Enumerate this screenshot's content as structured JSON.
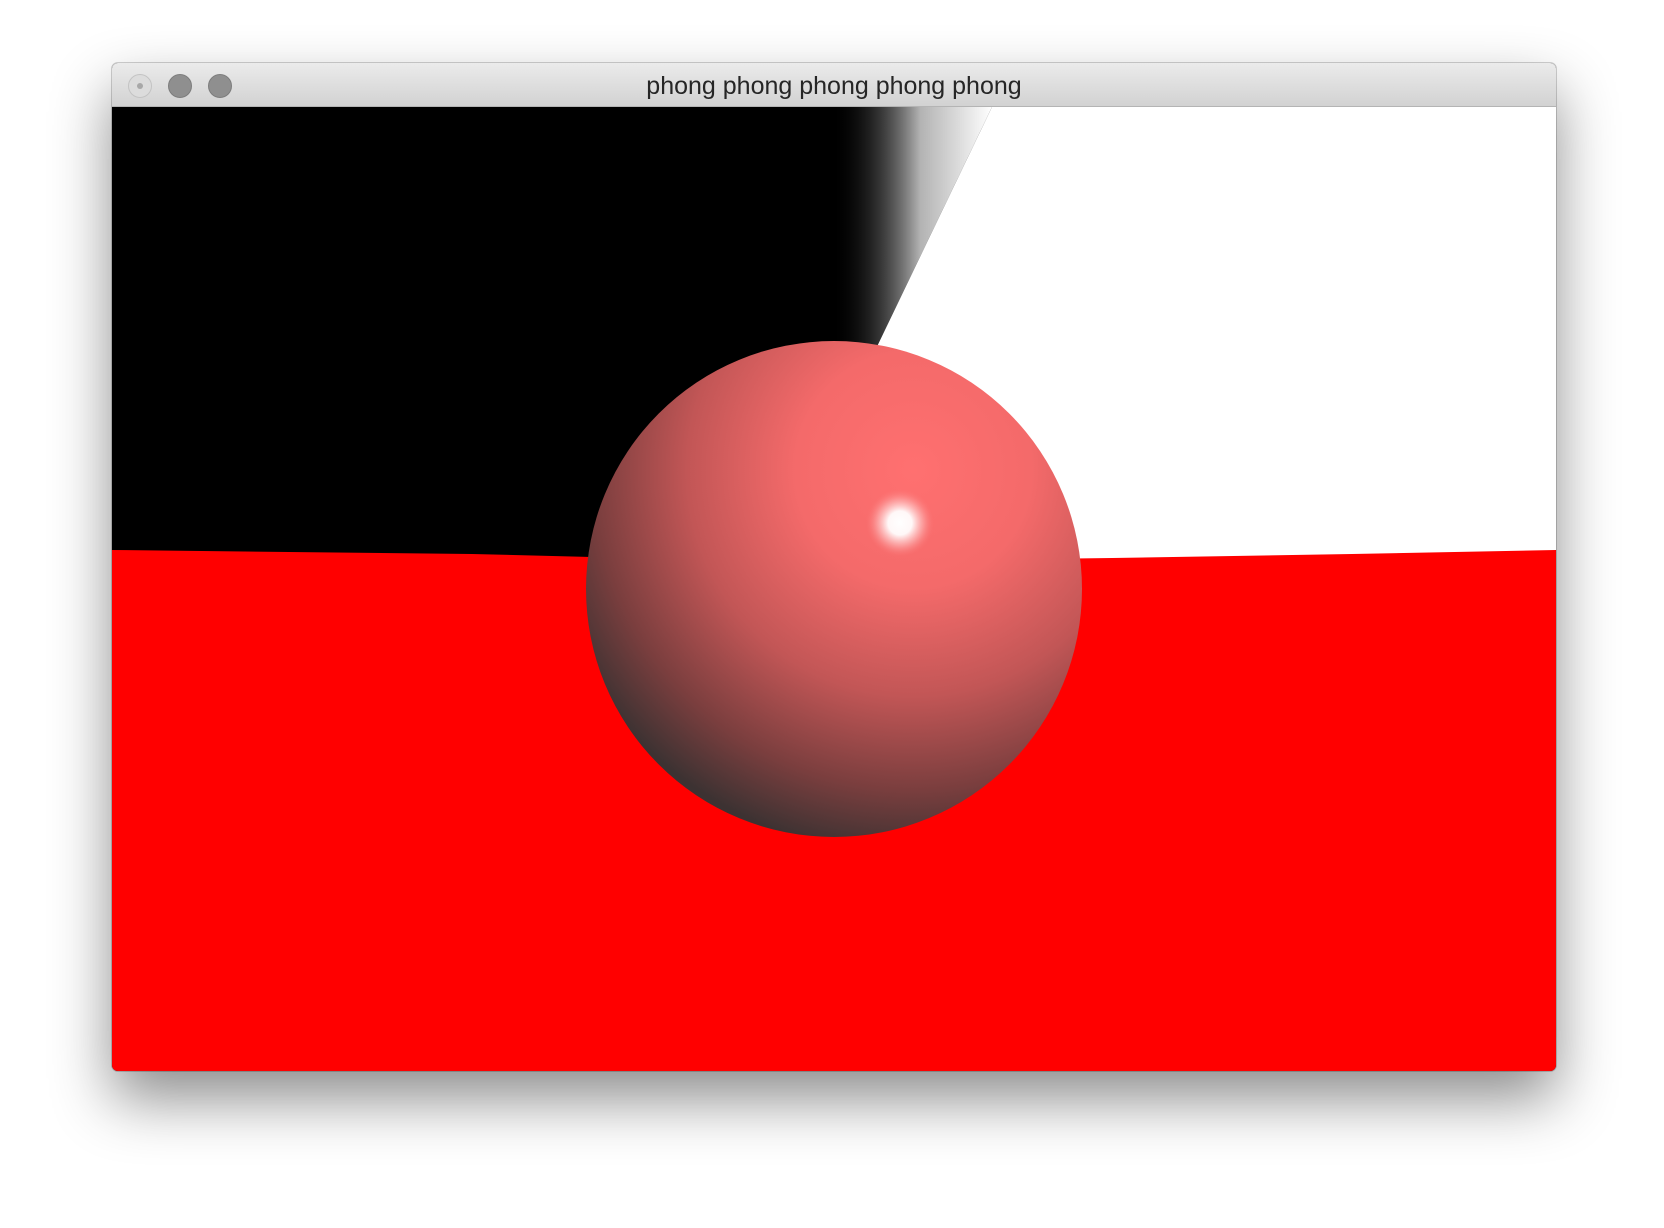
{
  "window": {
    "title": "phong phong phong phong phong"
  },
  "scene": {
    "background_left_color": "#000000",
    "background_right_color": "#ffffff",
    "floor_color": "#ff0000",
    "sphere_base_color": "#ff6e6e",
    "sphere_shadow_color": "#333333",
    "specular_color": "#ffffff"
  }
}
